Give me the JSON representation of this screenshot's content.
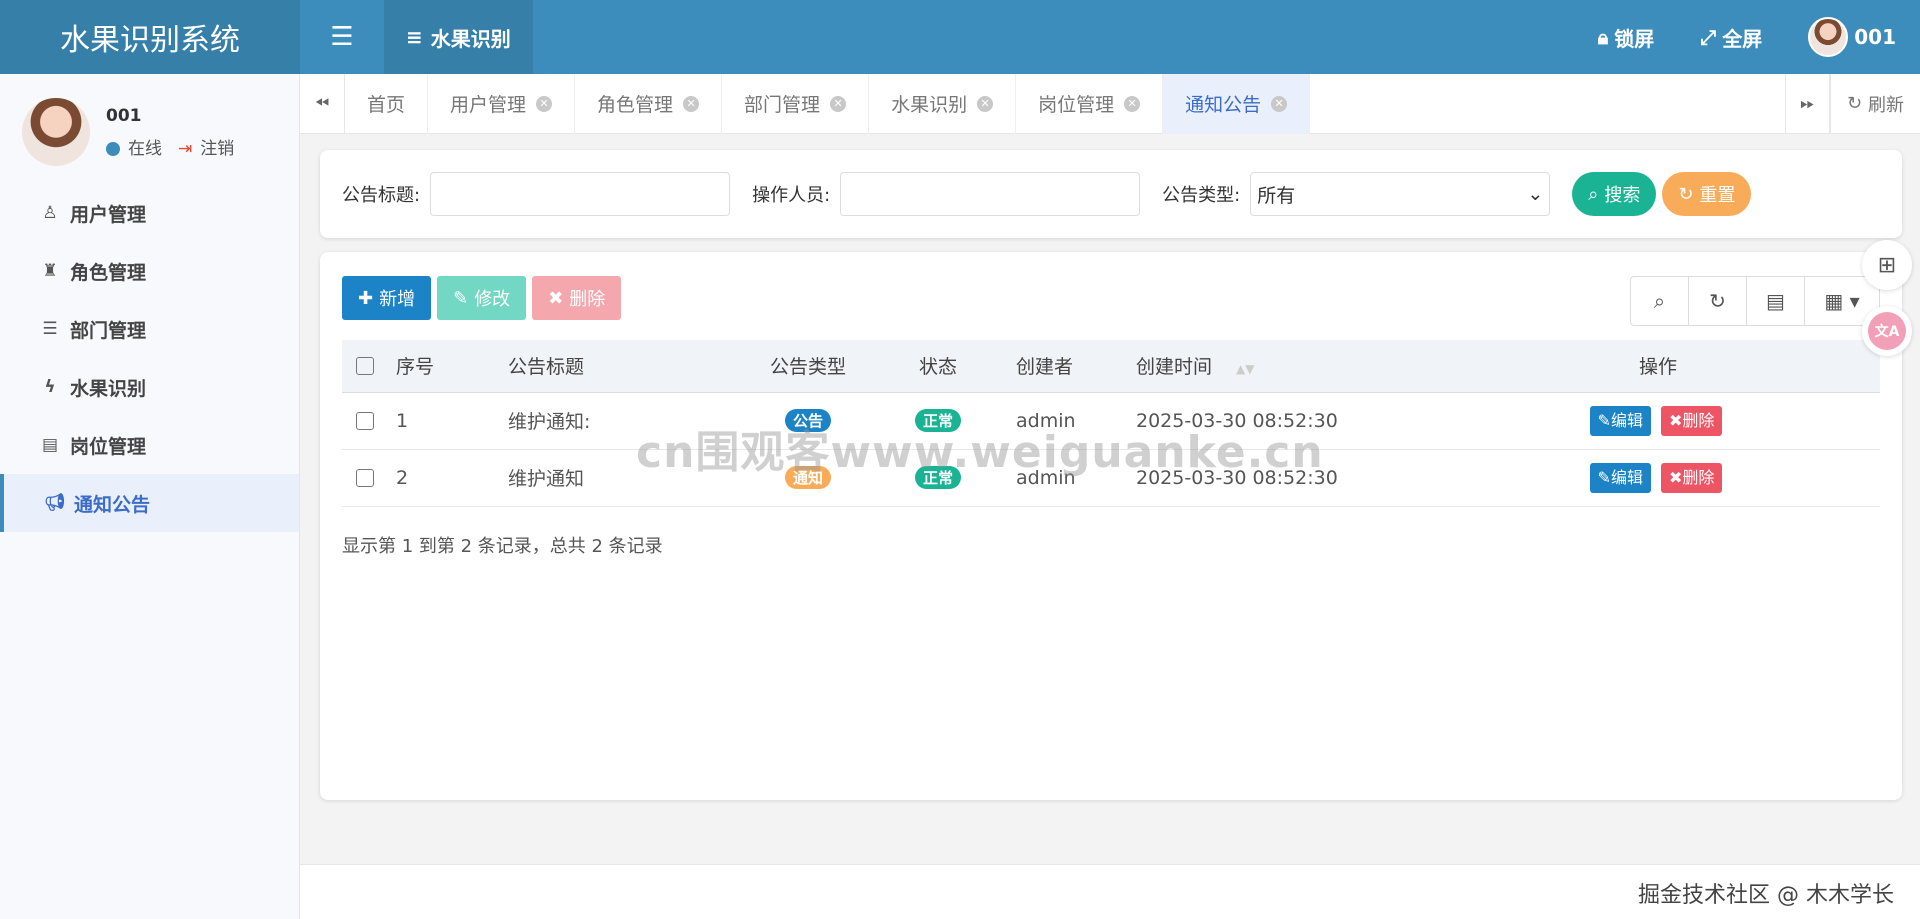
{
  "header": {
    "brand": "水果识别系统",
    "tab_label": "水果识别",
    "lock_label": "锁屏",
    "fullscreen_label": "全屏",
    "user_name": "001"
  },
  "sidebar": {
    "user_name": "001",
    "status_label": "在线",
    "logout_label": "注销",
    "items": [
      {
        "label": "用户管理",
        "icon": "user-icon"
      },
      {
        "label": "角色管理",
        "icon": "role-icon"
      },
      {
        "label": "部门管理",
        "icon": "dept-icon"
      },
      {
        "label": "水果识别",
        "icon": "bolt-icon"
      },
      {
        "label": "岗位管理",
        "icon": "idcard-icon"
      },
      {
        "label": "通知公告",
        "icon": "bullhorn-icon"
      }
    ]
  },
  "tabs": {
    "items": [
      "首页",
      "用户管理",
      "角色管理",
      "部门管理",
      "水果识别",
      "岗位管理",
      "通知公告"
    ],
    "refresh_label": "刷新"
  },
  "search": {
    "title_label": "公告标题:",
    "operator_label": "操作人员:",
    "type_label": "公告类型:",
    "type_value": "所有",
    "search_button": "搜索",
    "reset_button": "重置"
  },
  "toolbar": {
    "add": "新增",
    "edit": "修改",
    "delete": "删除"
  },
  "table": {
    "columns": [
      "序号",
      "公告标题",
      "公告类型",
      "状态",
      "创建者",
      "创建时间",
      "操作"
    ],
    "rows": [
      {
        "index": "1",
        "title": "维护通知:",
        "type": "公告",
        "status": "正常",
        "creator": "admin",
        "time": "2025-03-30 08:52:30"
      },
      {
        "index": "2",
        "title": "维护通知",
        "type": "通知",
        "status": "正常",
        "creator": "admin",
        "time": "2025-03-30 08:52:30"
      }
    ],
    "edit_label": "编辑",
    "delete_label": "删除",
    "pager_text": "显示第 1 到第 2 条记录，总共 2 条记录"
  },
  "watermark": "cn围观客www.weiguanke.cn",
  "footer": {
    "credit": "掘金技术社区 @ 木木学长"
  }
}
